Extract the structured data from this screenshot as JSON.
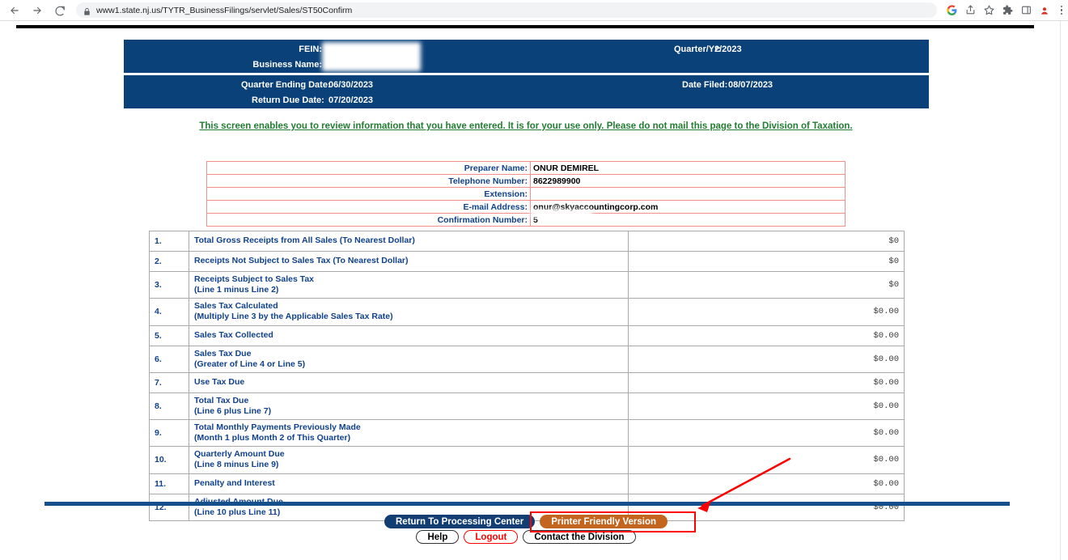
{
  "browser": {
    "url": "www1.state.nj.us/TYTR_BusinessFilings/servlet/Sales/ST50Confirm",
    "back_icon": "back-arrow-icon",
    "forward_icon": "forward-arrow-icon",
    "reload_icon": "reload-icon",
    "lock_icon": "lock-icon",
    "toolbar_icons": [
      "google-account-icon",
      "share-icon",
      "bookmark-star-icon",
      "extensions-puzzle-icon",
      "side-panel-icon",
      "profile-avatar-icon",
      "three-dot-menu-icon"
    ]
  },
  "header": {
    "fein_label": "FEIN:",
    "fein_value": "",
    "business_name_label": "Business Name:",
    "business_name_value": "",
    "quarter_yr_label": "Quarter/Yr:",
    "quarter_yr_value": "2/2023",
    "quarter_ending_label": "Quarter Ending Date:",
    "quarter_ending_value": "06/30/2023",
    "return_due_label": "Return Due Date:",
    "return_due_value": "07/20/2023",
    "date_filed_label": "Date Filed:",
    "date_filed_value": "08/07/2023"
  },
  "notice": "This screen enables you to review information that you have entered. It is for your use only. Please do not mail this page to the Division of Taxation.",
  "preparer": {
    "rows": [
      {
        "label": "Preparer Name:",
        "value": "ONUR DEMIREL"
      },
      {
        "label": "Telephone Number:",
        "value": "8622989900"
      },
      {
        "label": "Extension:",
        "value": ""
      },
      {
        "label": "E-mail Address:",
        "value": "onur@skyaccountingcorp.com"
      },
      {
        "label": "Confirmation Number:",
        "value": "5"
      }
    ]
  },
  "main_table": {
    "rows": [
      {
        "num": "1.",
        "desc": "Total Gross Receipts from All Sales (To Nearest Dollar)",
        "sub": "",
        "amount": "$0"
      },
      {
        "num": "2.",
        "desc": "Receipts Not Subject to Sales Tax (To Nearest Dollar)",
        "sub": "",
        "amount": "$0"
      },
      {
        "num": "3.",
        "desc": "Receipts Subject to Sales Tax",
        "sub": "(Line 1 minus Line 2)",
        "amount": "$0"
      },
      {
        "num": "4.",
        "desc": "Sales Tax Calculated",
        "sub": "(Multiply Line 3 by the Applicable Sales Tax Rate)",
        "amount": "$0.00"
      },
      {
        "num": "5.",
        "desc": "Sales Tax Collected",
        "sub": "",
        "amount": "$0.00"
      },
      {
        "num": "6.",
        "desc": "Sales Tax Due",
        "sub": "(Greater of Line 4 or Line 5)",
        "amount": "$0.00"
      },
      {
        "num": "7.",
        "desc": "Use Tax Due",
        "sub": "",
        "amount": "$0.00"
      },
      {
        "num": "8.",
        "desc": "Total Tax Due",
        "sub": "(Line 6 plus Line 7)",
        "amount": "$0.00"
      },
      {
        "num": "9.",
        "desc": "Total Monthly Payments Previously Made",
        "sub": "(Month 1 plus Month 2 of This Quarter)",
        "amount": "$0.00"
      },
      {
        "num": "10.",
        "desc": "Quarterly Amount Due",
        "sub": "(Line 8 minus Line 9)",
        "amount": "$0.00"
      },
      {
        "num": "11.",
        "desc": "Penalty and Interest",
        "sub": "",
        "amount": "$0.00"
      },
      {
        "num": "12.",
        "desc": "Adjusted Amount Due",
        "sub": "(Line 10 plus Line 11)",
        "amount": "$0.00"
      }
    ]
  },
  "buttons": {
    "return_to_processing_center": "Return To Processing Center",
    "printer_friendly_version": "Printer Friendly Version",
    "help": "Help",
    "logout": "Logout",
    "contact_the_division": "Contact the Division"
  },
  "annotation": {
    "arrow_color": "#ff0000",
    "highlight_color": "#ff0000",
    "target": "printer-friendly-version-button"
  },
  "colors": {
    "header_navy": "#0b4179",
    "notice_green": "#237d32",
    "table_label_blue": "#10418c",
    "preparer_border_red": "#f4908c",
    "button_orange": "#c4651f",
    "button_navy": "#123e73",
    "rule_blue": "#15508c"
  }
}
